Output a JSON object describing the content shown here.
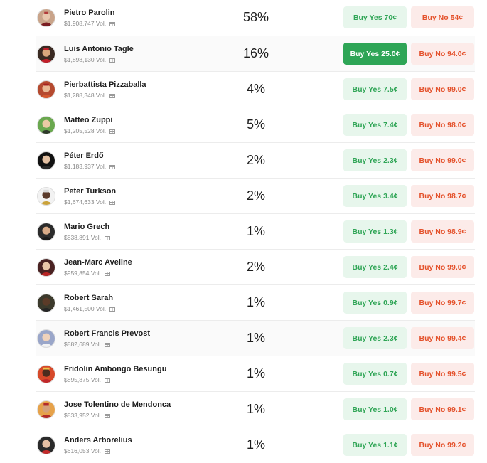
{
  "colors": {
    "yes_bg": "#e7f6ec",
    "yes_text": "#2fa556",
    "yes_solid_bg": "#2ea556",
    "no_bg": "#fcebe9",
    "no_text": "#e4512b"
  },
  "icons": {
    "volume_badge": "gift-icon"
  },
  "candidates": [
    {
      "name": "Pietro Parolin",
      "volume": "$1,908,747 Vol.",
      "percent": "58%",
      "yes": "Buy Yes 70¢",
      "no": "Buy No 54¢"
    },
    {
      "name": "Luis Antonio Tagle",
      "volume": "$1,898,130 Vol.",
      "percent": "16%",
      "yes": "Buy Yes 25.0¢",
      "no": "Buy No 94.0¢"
    },
    {
      "name": "Pierbattista Pizzaballa",
      "volume": "$1,288,348 Vol.",
      "percent": "4%",
      "yes": "Buy Yes 7.5¢",
      "no": "Buy No 99.0¢"
    },
    {
      "name": "Matteo Zuppi",
      "volume": "$1,205,528 Vol.",
      "percent": "5%",
      "yes": "Buy Yes 7.4¢",
      "no": "Buy No 98.0¢"
    },
    {
      "name": "Péter Erdő",
      "volume": "$1,183,937 Vol.",
      "percent": "2%",
      "yes": "Buy Yes 2.3¢",
      "no": "Buy No 99.0¢"
    },
    {
      "name": "Peter Turkson",
      "volume": "$1,674,633 Vol.",
      "percent": "2%",
      "yes": "Buy Yes 3.4¢",
      "no": "Buy No 98.7¢"
    },
    {
      "name": "Mario Grech",
      "volume": "$838,891 Vol.",
      "percent": "1%",
      "yes": "Buy Yes 1.3¢",
      "no": "Buy No 98.9¢"
    },
    {
      "name": "Jean-Marc Aveline",
      "volume": "$959,854 Vol.",
      "percent": "2%",
      "yes": "Buy Yes 2.4¢",
      "no": "Buy No 99.0¢"
    },
    {
      "name": "Robert Sarah",
      "volume": "$1,461,500 Vol.",
      "percent": "1%",
      "yes": "Buy Yes 0.9¢",
      "no": "Buy No 99.7¢"
    },
    {
      "name": "Robert Francis Prevost",
      "volume": "$882,689 Vol.",
      "percent": "1%",
      "yes": "Buy Yes 2.3¢",
      "no": "Buy No 99.4¢"
    },
    {
      "name": "Fridolin Ambongo Besungu",
      "volume": "$895,875 Vol.",
      "percent": "1%",
      "yes": "Buy Yes 0.7¢",
      "no": "Buy No 99.5¢"
    },
    {
      "name": "Jose Tolentino de Mendonca",
      "volume": "$833,952 Vol.",
      "percent": "1%",
      "yes": "Buy Yes 1.0¢",
      "no": "Buy No 99.1¢"
    },
    {
      "name": "Anders Arborelius",
      "volume": "$616,053 Vol.",
      "percent": "1%",
      "yes": "Buy Yes 1.1¢",
      "no": "Buy No 99.2¢"
    }
  ]
}
